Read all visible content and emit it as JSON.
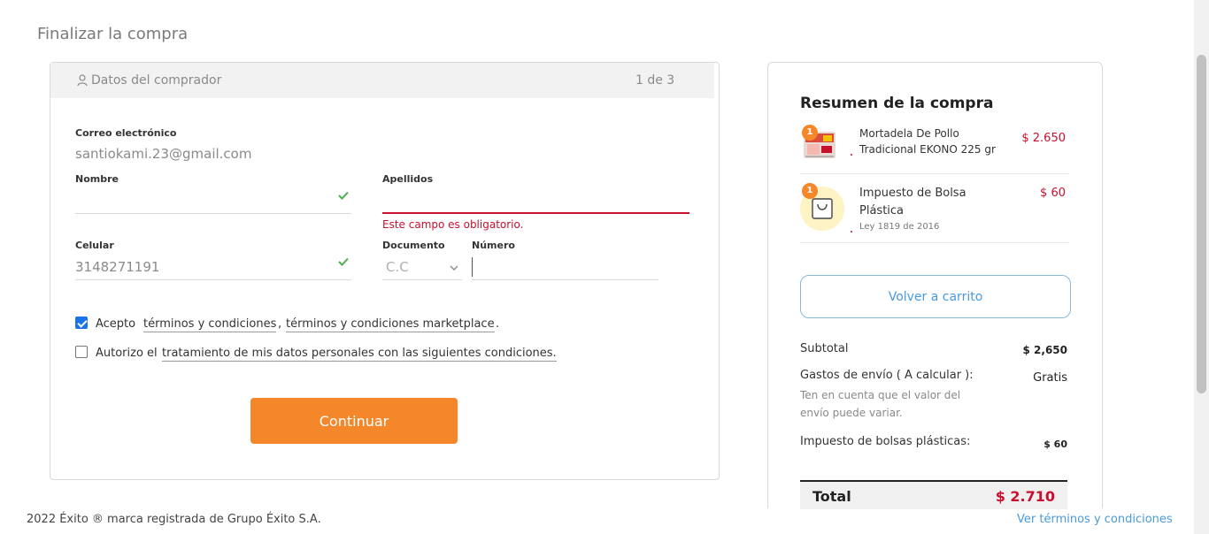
{
  "page": {
    "title": "Finalizar la compra"
  },
  "form": {
    "header": {
      "title": "Datos del comprador",
      "step": "1 de 3"
    },
    "email": {
      "label": "Correo electrónico",
      "value": "santiokami.23@gmail.com"
    },
    "nombre": {
      "label": "Nombre",
      "value": ""
    },
    "apellidos": {
      "label": "Apellidos",
      "value": "",
      "error": "Este campo es obligatorio."
    },
    "celular": {
      "label": "Celular",
      "value": "3148271191"
    },
    "documento": {
      "label": "Documento",
      "value": "C.C"
    },
    "numero": {
      "label": "Número",
      "value": ""
    },
    "terms": {
      "checked": true,
      "prefix": "Acepto",
      "link1": "términos y condiciones",
      "separator": ",",
      "link2": "términos y condiciones marketplace",
      "suffix": "."
    },
    "privacy": {
      "checked": false,
      "prefix": "Autorizo el",
      "link": "tratamiento de mis datos personales con las siguientes condiciones."
    },
    "continue_label": "Continuar"
  },
  "summary": {
    "title": "Resumen de la compra",
    "items": [
      {
        "qty": "1",
        "name": "Mortadela De Pollo Tradicional EKONO 225 gr",
        "price": "$ 2.650",
        "icon": "product-image-icon"
      },
      {
        "qty": "1",
        "name": "Impuesto de Bolsa Plástica",
        "sub": "Ley 1819 de 2016",
        "price": "$ 60",
        "icon": "shopping-bag-icon"
      }
    ],
    "back_label": "Volver a carrito",
    "subtotal": {
      "label": "Subtotal",
      "value": "$ 2,650"
    },
    "shipping": {
      "label": "Gastos de envío ( A calcular ):",
      "value": "Gratis",
      "note": "Ten en cuenta que el valor del envío puede variar."
    },
    "bags": {
      "label": "Impuesto de bolsas plásticas:",
      "value": "$ 60"
    },
    "total": {
      "label": "Total",
      "value": "$ 2.710"
    }
  },
  "footer": {
    "copyright": "2022 Éxito ® marca registrada de Grupo Éxito S.A.",
    "terms_link": "Ver términos y condiciones"
  },
  "colors": {
    "accent": "#f5872b",
    "error": "#c8102e",
    "link": "#4a9ad9",
    "success": "#4caf50"
  }
}
